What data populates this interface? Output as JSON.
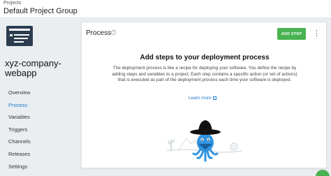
{
  "header": {
    "breadcrumb": "Projects",
    "group_title": "Default Project Group"
  },
  "sidebar": {
    "project_name": "xyz-company-webapp",
    "items": [
      {
        "label": "Overview",
        "active": false
      },
      {
        "label": "Process",
        "active": true
      },
      {
        "label": "Variables",
        "active": false
      },
      {
        "label": "Triggers",
        "active": false
      },
      {
        "label": "Channels",
        "active": false
      },
      {
        "label": "Releases",
        "active": false
      },
      {
        "label": "Settings",
        "active": false
      }
    ]
  },
  "panel": {
    "title": "Process",
    "help_icon": "question-circle-icon",
    "add_step_label": "ADD STEP",
    "more_icon": "vertical-ellipsis-icon",
    "empty_heading": "Add steps to your deployment process",
    "empty_description": "The deployment process is like a recipe for deploying your software. You define the recipe by adding steps and variables to a project. Each step contains a specific action (or set of actions) that is executed as part of the deployment process each time your software is deployed.",
    "learn_more": "Learn more"
  },
  "colors": {
    "accent_blue": "#1a77ca",
    "button_green": "#48b350",
    "sidebar_bg": "#eaeef1",
    "logo_dark": "#2b3d4f"
  }
}
